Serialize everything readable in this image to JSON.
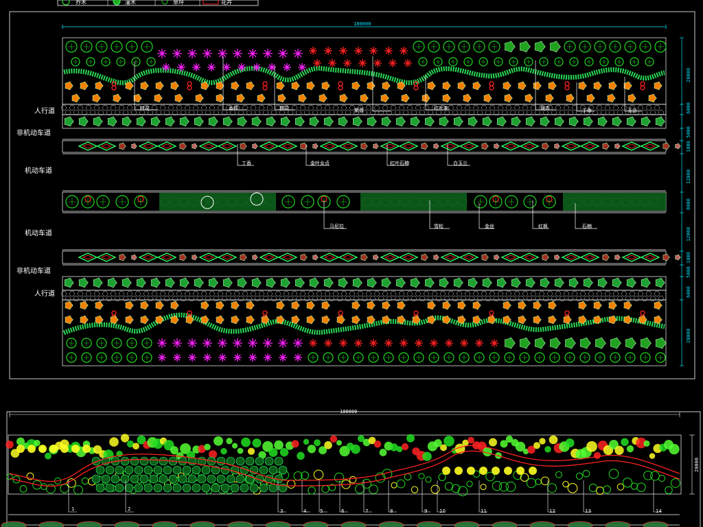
{
  "legend": {
    "items": [
      {
        "label": "乔木"
      },
      {
        "label": "灌木"
      },
      {
        "label": "草坪"
      },
      {
        "label": "花卉"
      }
    ]
  },
  "plan": {
    "overall_dimension": "180000",
    "row_labels": {
      "sidewalk_top": "人行道",
      "nonmotor_top": "非机动车道",
      "motor_top": "机动车道",
      "motor_bottom": "机动车道",
      "nonmotor_bottom": "非机动车道",
      "sidewalk_bottom": "人行道"
    },
    "right_dimensions": [
      "20000",
      "6000",
      "5000",
      "1000",
      "12000",
      "8000",
      "12000",
      "1000",
      "5000",
      "6000",
      "20000"
    ],
    "callouts_top": [
      "桂花",
      "香樟",
      "樱花",
      "紫薇",
      "红叶李",
      "银杏",
      "丁香",
      "玉兰"
    ],
    "callouts_median_strip": [
      "丁香",
      "金叶女贞",
      "红叶石楠",
      "白玉兰"
    ],
    "callouts_central": [
      "马尼拉",
      "雪松",
      "金丝",
      "红枫",
      "石楠"
    ]
  },
  "section": {
    "overall_dimension": "180000",
    "right_dimension": "20000",
    "bottom_markers": [
      "1",
      "2",
      "3",
      "4",
      "5",
      "6",
      "7",
      "8",
      "9",
      "10",
      "11",
      "12",
      "13",
      "14"
    ]
  },
  "colors": {
    "tree_green": "#22dd22",
    "shrub_green": "#33ff66",
    "magenta": "#ff22ff",
    "red": "#ff2222",
    "orange": "#ff8800",
    "yellow": "#ffff22",
    "cyan_frame": "#00e5ff",
    "white": "#ffffff",
    "pale_green": "#bbffbb"
  }
}
